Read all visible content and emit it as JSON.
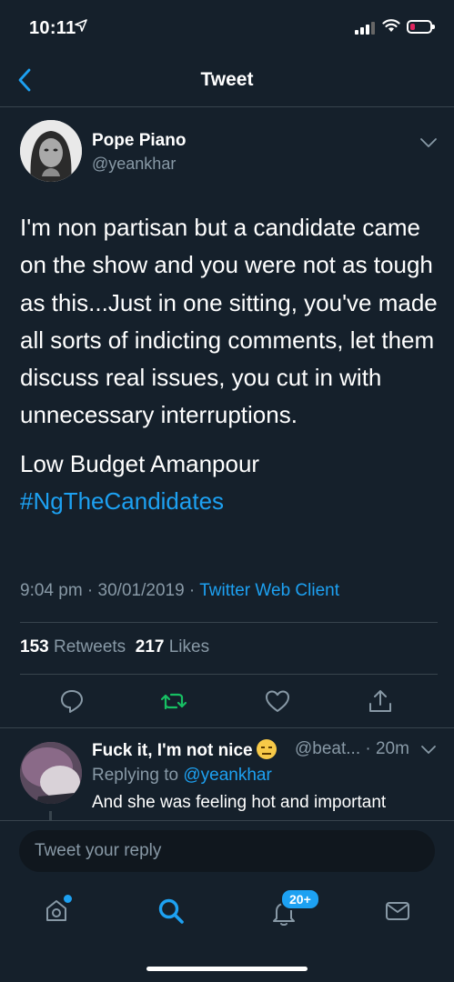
{
  "status_bar": {
    "time": "10:11"
  },
  "header": {
    "title": "Tweet"
  },
  "tweet": {
    "author_name": "Pope Piano",
    "author_handle": "@yeankhar",
    "body_paragraph_1": "I'm non partisan but a candidate came on the show and you were not as tough as this...Just in one sitting, you've made all sorts of indicting comments, let them discuss real issues, you cut in with unnecessary interruptions.",
    "body_line_2": "Low Budget Amanpour",
    "hashtag": "#NgTheCandidates",
    "time": "9:04 pm",
    "date": "30/01/2019",
    "client": "Twitter Web Client",
    "retweets_count": "153",
    "retweets_label": "Retweets",
    "likes_count": "217",
    "likes_label": "Likes"
  },
  "reply": {
    "name": "Fuck it, I'm not nice",
    "handle_time": "@beat... · 20m",
    "replying_prefix": "Replying to",
    "replying_to": "@yeankhar",
    "text": "And she was feeling hot and important"
  },
  "composer": {
    "placeholder": "Tweet your reply"
  },
  "tabbar": {
    "notifications_badge": "20+"
  },
  "colors": {
    "background": "#15202b",
    "accent": "#1da1f2",
    "retweet": "#17bf63",
    "muted": "#8899a6"
  }
}
